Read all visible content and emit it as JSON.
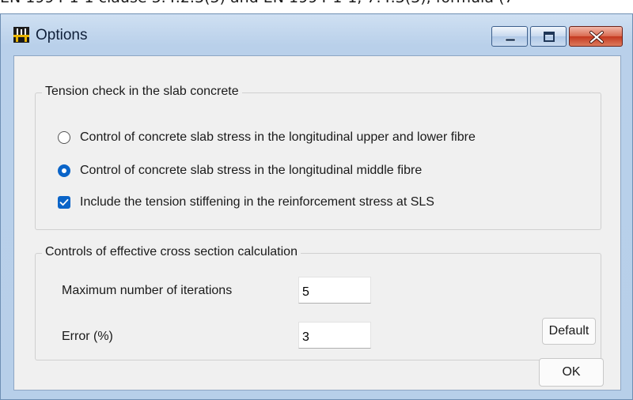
{
  "background": {
    "partial_text": "EN 1994-1-1 clause 5.4.2.3(5) and EN 1994-1-1, 7.4.3(3), formula (7"
  },
  "window": {
    "title": "Options",
    "icons": {
      "app": "app-icon",
      "minimize": "minimize-icon",
      "maximize": "maximize-icon",
      "close": "close-icon"
    }
  },
  "tension_group": {
    "title": "Tension check in the slab concrete",
    "options": [
      {
        "label": "Control of concrete slab stress in the longitudinal upper and lower fibre",
        "selected": false
      },
      {
        "label": "Control of concrete slab stress in the longitudinal middle fibre",
        "selected": true
      }
    ],
    "checkbox": {
      "label": "Include the tension stiffening in  the  reinforcement stress at SLS",
      "checked": true
    }
  },
  "cross_section_group": {
    "title": "Controls of effective cross section calculation",
    "max_iterations": {
      "label": "Maximum number of iterations",
      "value": "5"
    },
    "error": {
      "label": "Error (%)",
      "value": "3"
    },
    "default_button": "Default"
  },
  "ok_button": "OK",
  "colors": {
    "accent": "#0a64c8",
    "title_bar": "#b9d0ea",
    "close_button": "#c4381f",
    "dialog_bg": "#f0f0f0"
  }
}
